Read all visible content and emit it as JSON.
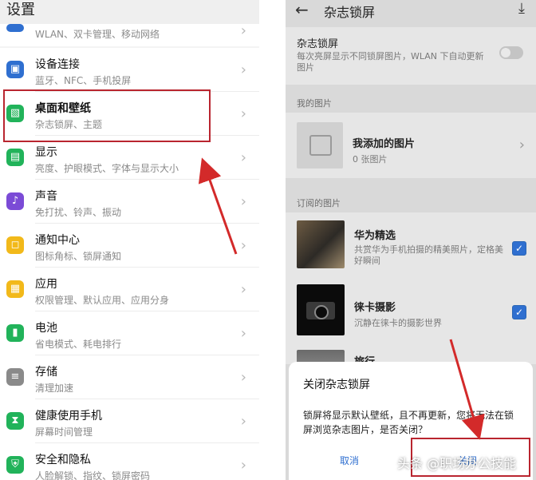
{
  "left": {
    "title": "设置",
    "rows": [
      {
        "title": "",
        "subtitle": "WLAN、双卡管理、移动网络",
        "icon": "wifi-icon",
        "color": "#2f6fd0"
      },
      {
        "title": "设备连接",
        "subtitle": "蓝牙、NFC、手机投屏",
        "icon": "devices-icon",
        "color": "#2f6fd0"
      },
      {
        "title": "桌面和壁纸",
        "subtitle": "杂志锁屏、主题",
        "icon": "wallpaper-icon",
        "color": "#21b35a"
      },
      {
        "title": "显示",
        "subtitle": "亮度、护眼模式、字体与显示大小",
        "icon": "display-icon",
        "color": "#21b35a"
      },
      {
        "title": "声音",
        "subtitle": "免打扰、铃声、振动",
        "icon": "sound-icon",
        "color": "#7b4bd6"
      },
      {
        "title": "通知中心",
        "subtitle": "图标角标、锁屏通知",
        "icon": "notification-icon",
        "color": "#f2b91a"
      },
      {
        "title": "应用",
        "subtitle": "权限管理、默认应用、应用分身",
        "icon": "apps-icon",
        "color": "#f2b91a"
      },
      {
        "title": "电池",
        "subtitle": "省电模式、耗电排行",
        "icon": "battery-icon",
        "color": "#21b35a"
      },
      {
        "title": "存储",
        "subtitle": "清理加速",
        "icon": "storage-icon",
        "color": "#8a8a8a"
      },
      {
        "title": "健康使用手机",
        "subtitle": "屏幕时间管理",
        "icon": "hourglass-icon",
        "color": "#21b35a"
      },
      {
        "title": "安全和隐私",
        "subtitle": "人脸解锁、指纹、锁屏密码",
        "icon": "shield-icon",
        "color": "#21b35a"
      }
    ]
  },
  "right": {
    "header": {
      "back": "←",
      "title": "杂志锁屏",
      "download": "⤓"
    },
    "magazine": {
      "title": "杂志锁屏",
      "desc": "每次亮屏显示不同锁屏图片，WLAN 下自动更新图片"
    },
    "mine": {
      "section": "我的图片",
      "title": "我添加的图片",
      "count": "0 张图片"
    },
    "subscribed": {
      "section": "订阅的图片",
      "items": [
        {
          "title": "华为精选",
          "desc": "共赏华为手机拍摄的精美照片，定格美好瞬间"
        },
        {
          "title": "徕卡摄影",
          "desc": "沉静在徕卡的摄影世界"
        },
        {
          "title": "旅行"
        }
      ]
    },
    "dialog": {
      "title": "关闭杂志锁屏",
      "body": "锁屏将显示默认壁纸，且不再更新，您将无法在锁屏浏览杂志图片，是否关闭？",
      "cancel": "取消",
      "confirm": "关闭"
    }
  },
  "watermark": "头条 @职场办公技能"
}
